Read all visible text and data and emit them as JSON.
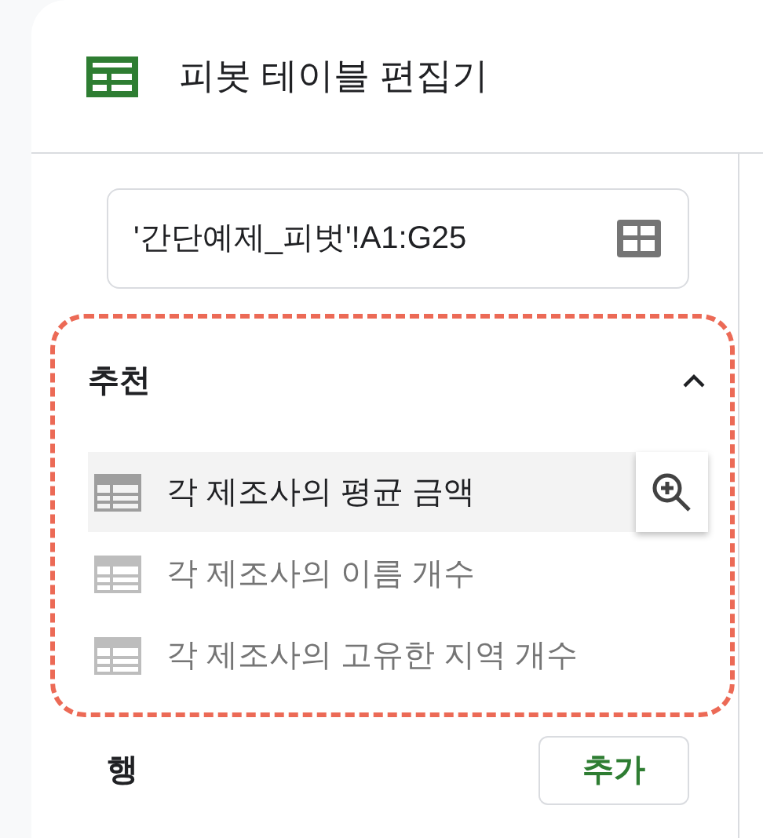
{
  "header": {
    "title": "피봇 테이블 편집기"
  },
  "range_field": {
    "value": "'간단예제_피벗'!A1:G25"
  },
  "suggestions": {
    "title": "추천",
    "expanded": true,
    "items": [
      {
        "label": "각 제조사의 평균 금액",
        "hovered": true
      },
      {
        "label": "각 제조사의 이름 개수",
        "hovered": false
      },
      {
        "label": "각 제조사의 고유한 지역 개수",
        "hovered": false
      }
    ]
  },
  "rows_section": {
    "label": "행",
    "add_button": "추가"
  }
}
